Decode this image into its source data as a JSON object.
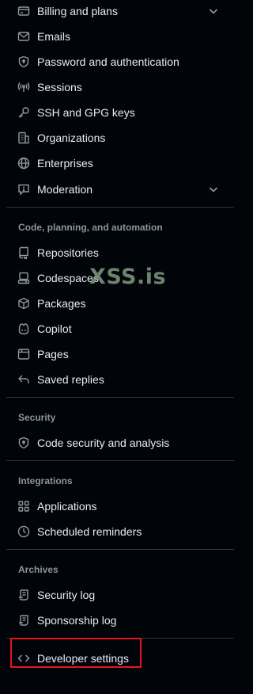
{
  "account_items": [
    {
      "label": "Billing and plans",
      "icon": "credit-card-icon",
      "expandable": true
    },
    {
      "label": "Emails",
      "icon": "mail-icon"
    },
    {
      "label": "Password and authentication",
      "icon": "shield-lock-icon"
    },
    {
      "label": "Sessions",
      "icon": "broadcast-icon"
    },
    {
      "label": "SSH and GPG keys",
      "icon": "key-icon"
    },
    {
      "label": "Organizations",
      "icon": "organization-icon"
    },
    {
      "label": "Enterprises",
      "icon": "globe-icon"
    },
    {
      "label": "Moderation",
      "icon": "report-icon",
      "expandable": true
    }
  ],
  "sections": {
    "code": {
      "title": "Code, planning, and automation",
      "items": [
        {
          "label": "Repositories",
          "icon": "repo-icon"
        },
        {
          "label": "Codespaces",
          "icon": "codespaces-icon"
        },
        {
          "label": "Packages",
          "icon": "package-icon"
        },
        {
          "label": "Copilot",
          "icon": "copilot-icon"
        },
        {
          "label": "Pages",
          "icon": "browser-icon"
        },
        {
          "label": "Saved replies",
          "icon": "reply-icon"
        }
      ]
    },
    "security": {
      "title": "Security",
      "items": [
        {
          "label": "Code security and analysis",
          "icon": "shield-lock-icon"
        }
      ]
    },
    "integrations": {
      "title": "Integrations",
      "items": [
        {
          "label": "Applications",
          "icon": "apps-icon"
        },
        {
          "label": "Scheduled reminders",
          "icon": "clock-icon"
        }
      ]
    },
    "archives": {
      "title": "Archives",
      "items": [
        {
          "label": "Security log",
          "icon": "log-icon"
        },
        {
          "label": "Sponsorship log",
          "icon": "log-icon"
        }
      ]
    }
  },
  "developer_settings": {
    "label": "Developer settings",
    "icon": "code-icon"
  },
  "watermark": "XSS.is",
  "colors": {
    "background": "#010409",
    "text": "#e6edf3",
    "muted": "#8b949e",
    "divider": "#30363d",
    "highlight": "#e5161e"
  }
}
